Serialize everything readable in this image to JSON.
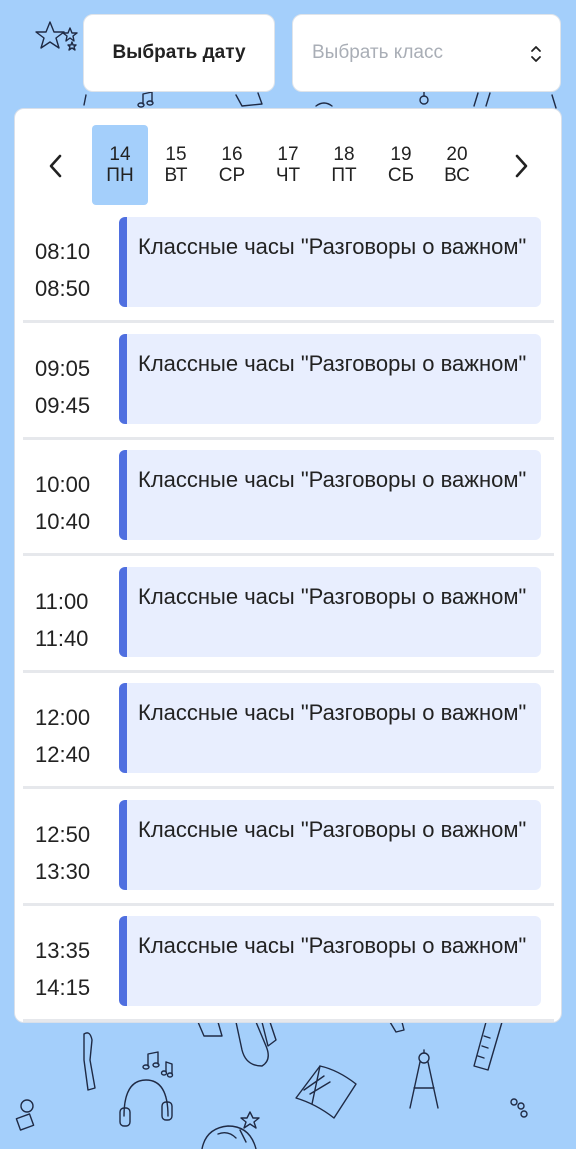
{
  "header": {
    "date_button_label": "Выбрать дату",
    "class_select_placeholder": "Выбрать класс"
  },
  "week": {
    "days": [
      {
        "num": "14",
        "name": "ПН",
        "selected": true
      },
      {
        "num": "15",
        "name": "ВТ",
        "selected": false
      },
      {
        "num": "16",
        "name": "СР",
        "selected": false
      },
      {
        "num": "17",
        "name": "ЧТ",
        "selected": false
      },
      {
        "num": "18",
        "name": "ПТ",
        "selected": false
      },
      {
        "num": "19",
        "name": "СБ",
        "selected": false
      },
      {
        "num": "20",
        "name": "ВС",
        "selected": false
      }
    ]
  },
  "schedule": [
    {
      "start": "08:10",
      "end": "08:50",
      "title": "Классные часы \"Разговоры о важном\""
    },
    {
      "start": "09:05",
      "end": "09:45",
      "title": "Классные часы \"Разговоры о важном\""
    },
    {
      "start": "10:00",
      "end": "10:40",
      "title": "Классные часы \"Разговоры о важном\""
    },
    {
      "start": "11:00",
      "end": "11:40",
      "title": "Классные часы \"Разговоры о важном\""
    },
    {
      "start": "12:00",
      "end": "12:40",
      "title": "Классные часы \"Разговоры о важном\""
    },
    {
      "start": "12:50",
      "end": "13:30",
      "title": "Классные часы \"Разговоры о важном\""
    },
    {
      "start": "13:35",
      "end": "14:15",
      "title": "Классные часы \"Разговоры о важном\""
    }
  ],
  "colors": {
    "background": "#a4cffb",
    "selected_day": "#a4cffb",
    "lesson_bg": "#e8eefe",
    "lesson_accent": "#4f6fe0"
  }
}
